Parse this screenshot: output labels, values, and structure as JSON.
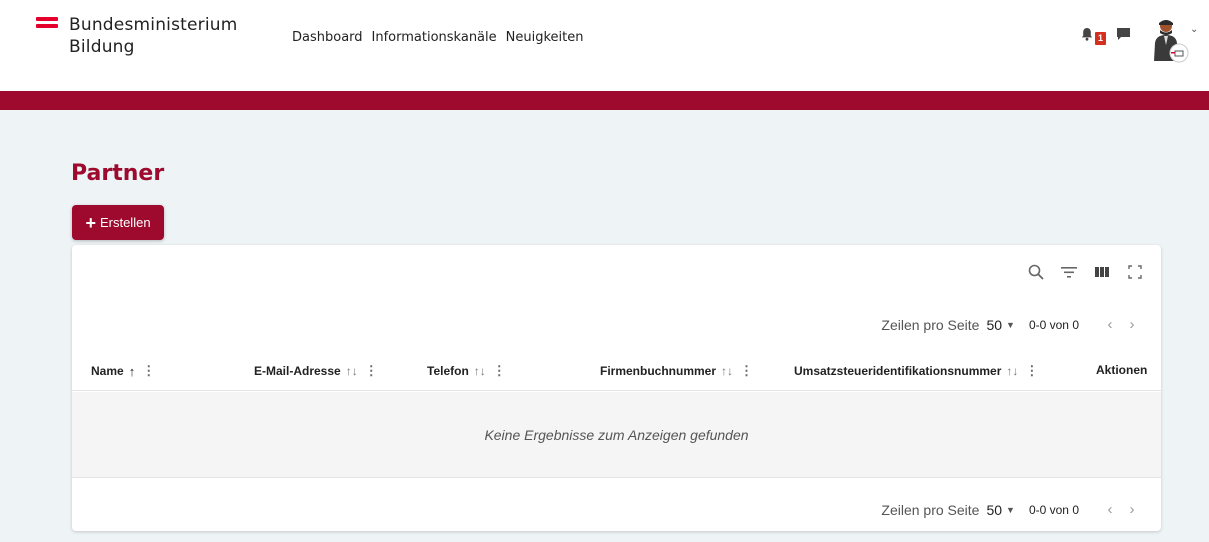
{
  "header": {
    "logo_line1": "Bundesministerium",
    "logo_line2": "Bildung",
    "nav": [
      "Dashboard",
      "Informationskanäle",
      "Neuigkeiten"
    ],
    "notification_count": "1",
    "icons": [
      "bell-icon",
      "chat-icon",
      "avatar",
      "chevron-down-icon"
    ]
  },
  "colors": {
    "brand": "#9e0a2e",
    "flag_red": "#e4002b",
    "badge": "#d4301f",
    "background": "#eef3f6"
  },
  "page": {
    "title": "Partner",
    "create_label": "Erstellen"
  },
  "table": {
    "toolbar_icons": [
      "search-icon",
      "filter-icon",
      "columns-icon",
      "fullscreen-icon"
    ],
    "columns": [
      {
        "label": "Name",
        "sort": "↑"
      },
      {
        "label": "E-Mail-Adresse",
        "sort": "↑↓"
      },
      {
        "label": "Telefon",
        "sort": "↑↓"
      },
      {
        "label": "Firmenbuchnummer",
        "sort": "↑↓"
      },
      {
        "label": "Umsatzsteueridentifikationsnummer",
        "sort": "↑↓"
      },
      {
        "label": "Aktionen"
      }
    ],
    "empty_message": "Keine Ergebnisse zum Anzeigen gefunden",
    "pagination": {
      "rows_label": "Zeilen pro Seite",
      "rows_value": "50",
      "count": "0-0 von 0"
    }
  }
}
